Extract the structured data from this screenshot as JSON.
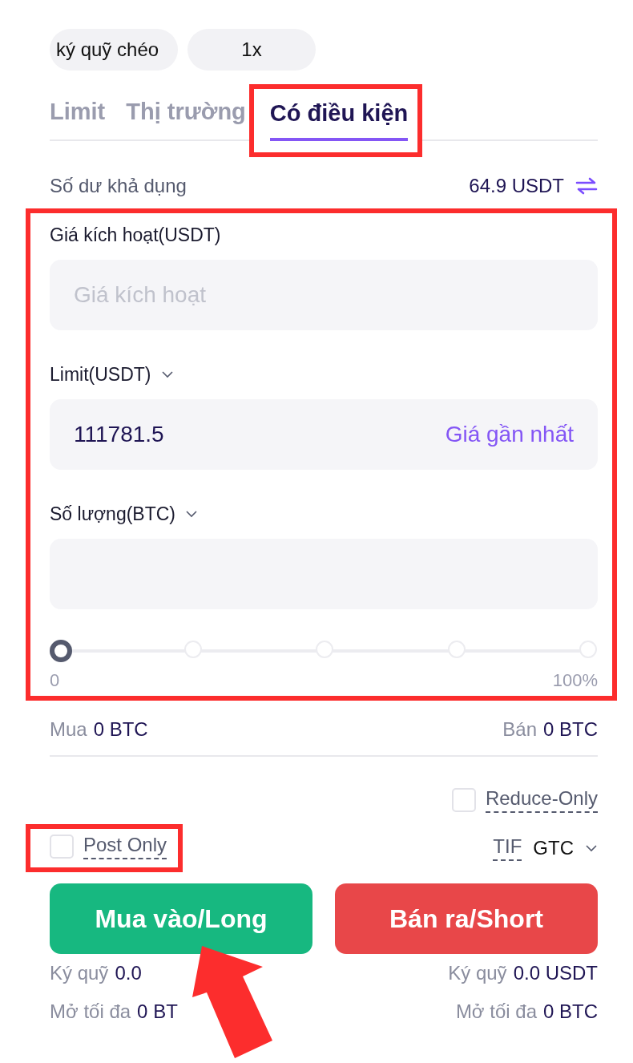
{
  "margin_buttons": [
    {
      "label": "ký quỹ chéo"
    },
    {
      "label": "1x"
    }
  ],
  "tabs": [
    {
      "label": "Limit",
      "selected": false,
      "highlighted": false
    },
    {
      "label": "Thị trường",
      "selected": false,
      "highlighted": false
    },
    {
      "label": "Có điều kiện",
      "selected": true,
      "highlighted": true
    }
  ],
  "balance": {
    "label": "Số dư khả dụng",
    "value": "64.9 USDT"
  },
  "order_form": {
    "highlighted": true,
    "fields": [
      {
        "label": "Giá kích hoạt(USDT)",
        "dropdown": false,
        "placeholder": "Giá kích hoạt"
      },
      {
        "label": "Limit(USDT)",
        "dropdown": true,
        "value": "111781.5",
        "action": "Giá gần nhất"
      },
      {
        "label": "Số lượng(BTC)",
        "dropdown": true
      }
    ],
    "slider": {
      "level": 0,
      "min_label": "0",
      "max_label": "100%"
    }
  },
  "totals": [
    {
      "label": "Mua",
      "value": "0 BTC"
    },
    {
      "label": "Bán",
      "value": "0 BTC"
    }
  ],
  "reduce_only": {
    "label": "Reduce-Only",
    "checked": false
  },
  "post_only": {
    "label": "Post Only",
    "checked": false,
    "highlighted": true
  },
  "tif": {
    "label": "TIF",
    "value": "GTC"
  },
  "actions": [
    {
      "label": "Mua vào/Long",
      "kind": "buy"
    },
    {
      "label": "Bán ra/Short",
      "kind": "sell"
    }
  ],
  "details": [
    [
      {
        "label": "Ký quỹ",
        "value": "0.0"
      },
      {
        "label": "Ký quỹ",
        "value": "0.0 USDT"
      }
    ],
    [
      {
        "label": "Mở tối đa",
        "value": "0 BT"
      },
      {
        "label": "Mở tối đa",
        "value": "0 BTC"
      }
    ]
  ],
  "annotation_arrow": true
}
